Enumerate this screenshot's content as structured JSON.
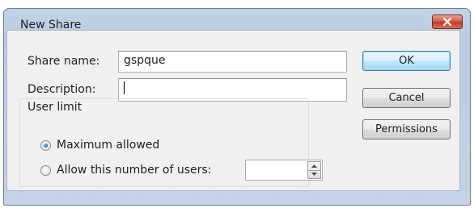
{
  "window": {
    "title": "New Share"
  },
  "form": {
    "share_name_label": "Share name:",
    "share_name_value": "gspque",
    "description_label": "Description:",
    "description_value": ""
  },
  "user_limit": {
    "group_label": "User limit",
    "max_allowed_label": "Maximum allowed",
    "max_allowed_selected": true,
    "allow_number_label": "Allow this number of users:",
    "allow_number_selected": false,
    "number_value": ""
  },
  "buttons": {
    "ok": "OK",
    "cancel": "Cancel",
    "permissions": "Permissions"
  },
  "icons": [
    "close-icon",
    "spin-up-icon",
    "spin-down-icon"
  ],
  "colors": {
    "close_button": "#c0392b",
    "title_bar": "#b9cbe0",
    "default_button_border": "#3c7fb1"
  }
}
